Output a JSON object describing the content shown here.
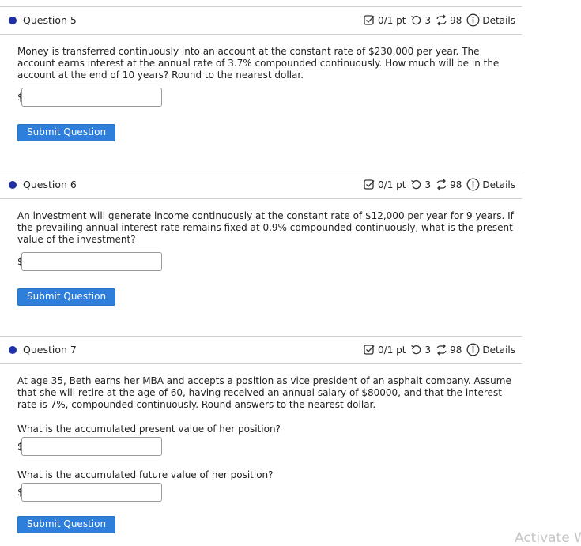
{
  "questions": [
    {
      "title": "Question 5",
      "score": "0/1 pt",
      "retries": "3",
      "attempts": "98",
      "details": "Details",
      "prompt": "Money is transferred continuously into an account at the constant rate of $230,000 per year. The account earns interest at the annual rate of 3.7% compounded continuously. How much will be in the account at the end of 10 years? Round to the nearest dollar.",
      "currency": "$",
      "input_value": "",
      "submit": "Submit Question"
    },
    {
      "title": "Question 6",
      "score": "0/1 pt",
      "retries": "3",
      "attempts": "98",
      "details": "Details",
      "prompt": "An investment will generate income continuously at the constant rate of $12,000 per year for 9 years. If the prevailing annual interest rate remains fixed at 0.9% compounded continuously, what is the present value of the investment?",
      "currency": "$",
      "input_value": "",
      "submit": "Submit Question"
    },
    {
      "title": "Question 7",
      "score": "0/1 pt",
      "retries": "3",
      "attempts": "98",
      "details": "Details",
      "prompt": "At age 35, Beth earns her MBA and accepts a position as vice president of an asphalt company. Assume that she will retire at the age of 60, having received an annual salary of $80000, and that the interest rate is 7%, compounded continuously. Round answers to the nearest dollar.",
      "part1_label": "What is the accumulated present value of her position?",
      "part2_label": "What is the accumulated future value of her position?",
      "currency": "$",
      "input1_value": "",
      "input2_value": "",
      "submit": "Submit Question"
    }
  ],
  "watermark": "Activate W",
  "colors": {
    "accent": "#2d7fdb",
    "dot": "#1f2fa8"
  },
  "icons": [
    "checkbox-icon",
    "retry-icon",
    "attempts-icon",
    "info-icon"
  ]
}
